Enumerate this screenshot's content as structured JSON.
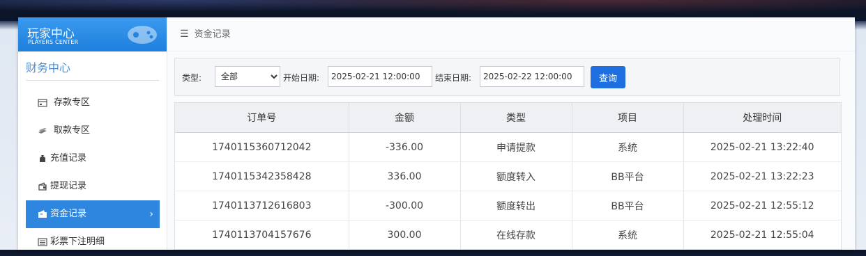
{
  "brand": {
    "title": "玩家中心",
    "subtitle": "PLAYERS CENTER"
  },
  "sidebar": {
    "section_title": "财务中心",
    "items": [
      {
        "label": "存款专区",
        "icon": "card-icon"
      },
      {
        "label": "取款专区",
        "icon": "cash-icon"
      },
      {
        "label": "充值记录",
        "icon": "money-bag-icon"
      },
      {
        "label": "提现记录",
        "icon": "wallet-icon"
      },
      {
        "label": "资金记录",
        "icon": "funds-icon",
        "active": true
      },
      {
        "label": "彩票下注明细",
        "icon": "list-icon"
      }
    ],
    "active_arrow": "›"
  },
  "breadcrumb": {
    "label": "资金记录"
  },
  "filter": {
    "type_label": "类型:",
    "type_value": "全部",
    "start_label": "开始日期:",
    "start_value": "2025-02-21 12:00:00",
    "end_label": "结束日期:",
    "end_value": "2025-02-22 12:00:00",
    "query_label": "查询"
  },
  "table": {
    "headers": [
      "订单号",
      "金额",
      "类型",
      "项目",
      "处理时间"
    ],
    "rows": [
      [
        "1740115360712042",
        "-336.00",
        "申请提款",
        "系统",
        "2025-02-21 13:22:40"
      ],
      [
        "1740115342358428",
        "336.00",
        "额度转入",
        "BB平台",
        "2025-02-21 13:22:23"
      ],
      [
        "1740113712616803",
        "-300.00",
        "额度转出",
        "BB平台",
        "2025-02-21 12:55:12"
      ],
      [
        "1740113704157676",
        "300.00",
        "在线存款",
        "系统",
        "2025-02-21 12:55:04"
      ]
    ]
  }
}
